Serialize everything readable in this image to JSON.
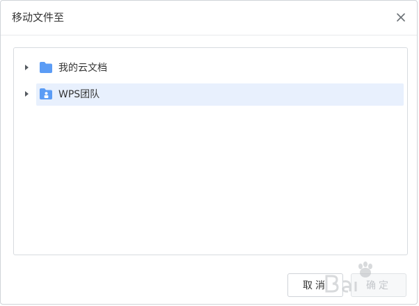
{
  "dialog": {
    "title": "移动文件至",
    "close_icon": "close-icon"
  },
  "tree": {
    "items": [
      {
        "label": "我的云文档",
        "icon": "folder-icon",
        "selected": false
      },
      {
        "label": "WPS团队",
        "icon": "team-folder-icon",
        "selected": true
      }
    ]
  },
  "buttons": {
    "cancel_label": "取消",
    "ok_label": "确定"
  },
  "colors": {
    "folder_blue": "#5b9cf5",
    "selected_bg": "#e8f0fd",
    "border": "#d7dbdf",
    "text": "#333333"
  }
}
